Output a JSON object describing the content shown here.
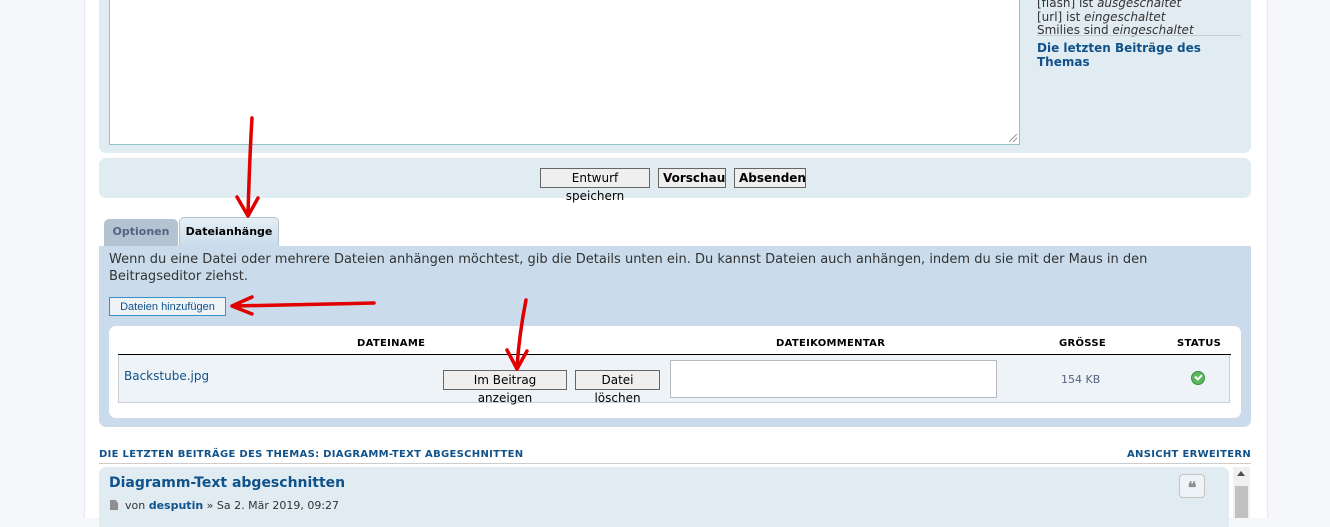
{
  "editor": {
    "info_lines": [
      {
        "prefix": "[flash] ist ",
        "value": "ausgeschaltet"
      },
      {
        "prefix": "[url] ist ",
        "value": "eingeschaltet"
      },
      {
        "prefix": "Smilies sind ",
        "value": "eingeschaltet"
      }
    ],
    "recent_posts_link": "Die letzten Beiträge des Themas"
  },
  "submit": {
    "draft_label": "Entwurf speichern",
    "preview_label": "Vorschau",
    "send_label": "Absenden"
  },
  "tabs": [
    {
      "label": "Optionen",
      "active": false
    },
    {
      "label": "Dateianhänge",
      "active": true
    }
  ],
  "attachments": {
    "help_text": "Wenn du eine Datei oder mehrere Dateien anhängen möchtest, gib die Details unten ein. Du kannst Dateien auch anhängen, indem du sie mit der Maus in den Beitragseditor ziehst.",
    "add_files_label": "Dateien hinzufügen",
    "columns": [
      "DATEINAME",
      "DATEIKOMMENTAR",
      "GRÖSSE",
      "STATUS"
    ],
    "rows": [
      {
        "filename": "Backstube.jpg",
        "show_in_post_label": "Im Beitrag anzeigen",
        "delete_label": "Datei löschen",
        "comment": "",
        "size": "154 KB",
        "status_icon": "check-circle-icon"
      }
    ]
  },
  "review": {
    "title": "DIE LETZTEN BEITRÄGE DES THEMAS: DIAGRAMM-TEXT ABGESCHNITTEN",
    "expand_label": "ANSICHT ERWEITERN",
    "post": {
      "title": "Diagramm-Text abgeschnitten",
      "by_label": "von",
      "author": "desputin",
      "date": "» Sa 2. Mär 2019, 09:27"
    }
  },
  "colors": {
    "panel": "#e1ebf2",
    "attach_panel": "#cadceb",
    "link": "#105289",
    "annotation_arrow": "#e00000"
  }
}
